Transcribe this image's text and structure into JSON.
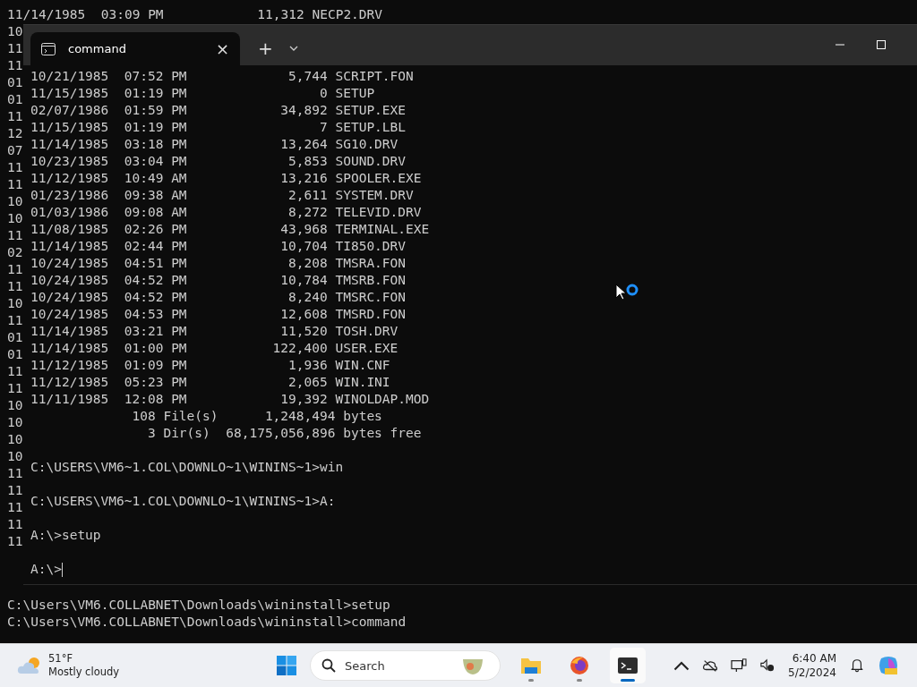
{
  "background_console": {
    "first_line": "11/14/1985  03:09 PM            11,312 NECP2.DRV",
    "line_fragments": [
      "10",
      "11",
      "11",
      "01",
      "01",
      "11",
      "12",
      "07",
      "11",
      "11",
      "10",
      "10",
      "11",
      "02",
      "11",
      "11",
      "10",
      "11",
      "01",
      "01",
      "11",
      "11",
      "10",
      "10",
      "10",
      "10",
      "11",
      "11",
      "11",
      "11",
      "11"
    ],
    "bottom_lines": [
      "C:\\Users\\VM6.COLLABNET\\Downloads\\wininstall>setup",
      "C:\\Users\\VM6.COLLABNET\\Downloads\\wininstall>command"
    ]
  },
  "terminal": {
    "tab": {
      "title": "command",
      "close": "×",
      "selected": true
    },
    "new_tab": "+",
    "lines": [
      "10/21/1985  07:52 PM             5,744 SCRIPT.FON",
      "11/15/1985  01:19 PM                 0 SETUP",
      "02/07/1986  01:59 PM            34,892 SETUP.EXE",
      "11/15/1985  01:19 PM                 7 SETUP.LBL",
      "11/14/1985  03:18 PM            13,264 SG10.DRV",
      "10/23/1985  03:04 PM             5,853 SOUND.DRV",
      "11/12/1985  10:49 AM            13,216 SPOOLER.EXE",
      "01/23/1986  09:38 AM             2,611 SYSTEM.DRV",
      "01/03/1986  09:08 AM             8,272 TELEVID.DRV",
      "11/08/1985  02:26 PM            43,968 TERMINAL.EXE",
      "11/14/1985  02:44 PM            10,704 TI850.DRV",
      "10/24/1985  04:51 PM             8,208 TMSRA.FON",
      "10/24/1985  04:52 PM            10,784 TMSRB.FON",
      "10/24/1985  04:52 PM             8,240 TMSRC.FON",
      "10/24/1985  04:53 PM            12,608 TMSRD.FON",
      "11/14/1985  03:21 PM            11,520 TOSH.DRV",
      "11/14/1985  01:00 PM           122,400 USER.EXE",
      "11/12/1985  01:09 PM             1,936 WIN.CNF",
      "11/12/1985  05:23 PM             2,065 WIN.INI",
      "11/11/1985  12:08 PM            19,392 WINOLDAP.MOD",
      "             108 File(s)      1,248,494 bytes",
      "               3 Dir(s)  68,175,056,896 bytes free"
    ],
    "prompts": [
      "C:\\USERS\\VM6~1.COL\\DOWNLO~1\\WININS~1>win",
      "C:\\USERS\\VM6~1.COL\\DOWNLO~1\\WININS~1>A:",
      "A:\\>setup",
      "A:\\>"
    ]
  },
  "taskbar": {
    "weather": {
      "temperature": "51°F",
      "condition": "Mostly cloudy"
    },
    "search": {
      "placeholder": "Search"
    },
    "apps": [
      {
        "kind": "explorer",
        "active": false
      },
      {
        "kind": "browser",
        "active": false
      },
      {
        "kind": "terminal",
        "active": true
      }
    ],
    "clock": {
      "time": "6:40 AM",
      "date": "5/2/2024"
    }
  }
}
